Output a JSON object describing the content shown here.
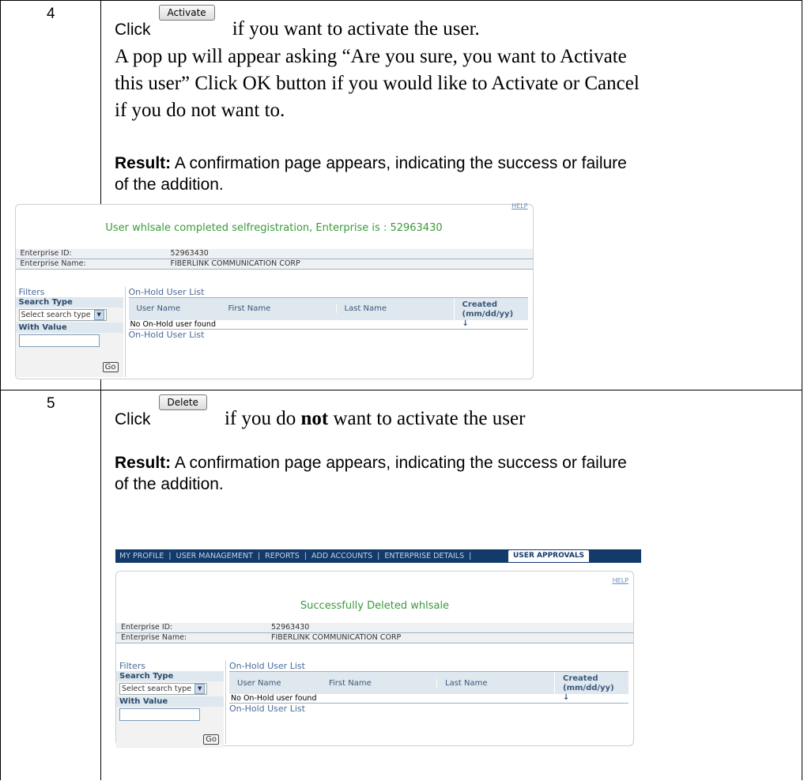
{
  "steps": [
    {
      "number": "4",
      "click_word": "Click",
      "button_label": "Activate",
      "line1_rest": "if you want to activate the user.",
      "para_lines": [
        "A pop up will appear asking “Are you sure, you want to Activate",
        "this user” Click OK button if you would like to Activate or Cancel",
        "if you do not want to."
      ],
      "result_label": "Result:",
      "result_text": " A confirmation page appears, indicating the success or failure",
      "result_text2": "of the addition.",
      "shot": {
        "message": "User whlsale completed selfregistration, Enterprise is : 52963430",
        "help": "HELP"
      }
    },
    {
      "number": "5",
      "click_word": "Click",
      "button_label": "Delete",
      "line1_pre": "if you do ",
      "line1_bold": "not",
      "line1_post": " want to activate the user",
      "result_label": "Result:",
      "result_text": " A confirmation page appears, indicating the success or failure",
      "result_text2": "of the addition.",
      "shot": {
        "message": "Successfully Deleted whlsale",
        "help": "HELP",
        "nav": [
          "MY PROFILE",
          "USER MANAGEMENT",
          "REPORTS",
          "ADD ACCOUNTS",
          "ENTERPRISE DETAILS"
        ],
        "nav_active": "USER APPROVALS"
      }
    }
  ],
  "enterprise": {
    "id_label": "Enterprise ID:",
    "id_value": "52963430",
    "name_label": "Enterprise Name:",
    "name_value": "FIBERLINK COMMUNICATION CORP"
  },
  "filters": {
    "title": "Filters",
    "search_type_label": "Search Type",
    "search_type_value": "Select search type",
    "with_value_label": "With Value",
    "go_label": "Go"
  },
  "list": {
    "title": "On-Hold User List",
    "columns": [
      "User Name",
      "First Name",
      "Last Name",
      "Created (mm/dd/yy)"
    ],
    "empty_text": "No On-Hold user found",
    "footer": "On-Hold User List"
  }
}
